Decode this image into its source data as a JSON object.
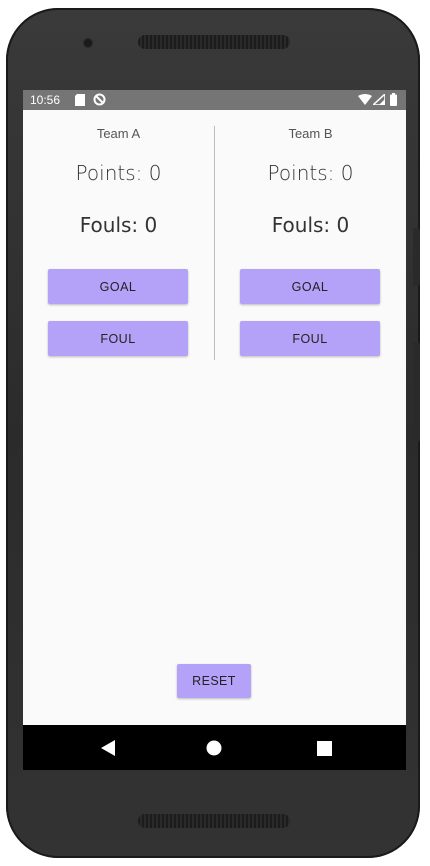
{
  "status_bar": {
    "time": "10:56",
    "icons_left": [
      "sd-card-icon",
      "sync-disabled-icon"
    ],
    "icons_right": [
      "wifi-icon",
      "signal-icon",
      "battery-icon"
    ]
  },
  "team_a": {
    "name": "Team A",
    "points_text": "Points: 0",
    "fouls_text": "Fouls: 0",
    "goal_label": "GOAL",
    "foul_label": "FOUL"
  },
  "team_b": {
    "name": "Team B",
    "points_text": "Points: 0",
    "fouls_text": "Fouls: 0",
    "goal_label": "GOAL",
    "foul_label": "FOUL"
  },
  "reset_label": "RESET",
  "navigation": {
    "buttons": [
      "back-icon",
      "home-icon",
      "recents-icon"
    ]
  },
  "colors": {
    "button": "#b3a2f7",
    "status_bar": "#757575",
    "screen_bg": "#fafafa",
    "nav_bar": "#000000"
  }
}
